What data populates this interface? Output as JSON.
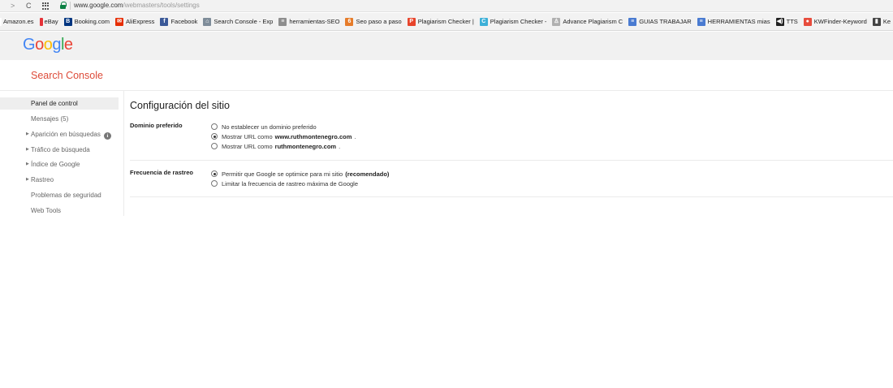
{
  "browser": {
    "url_domain": "www.google.com",
    "url_path": "/webmasters/tools/settings",
    "bookmarks": [
      {
        "label": "Amazon.es",
        "color": "#ffffff",
        "glyph": ""
      },
      {
        "label": "eBay",
        "color": "#e53238",
        "glyph": ""
      },
      {
        "label": "Booking.com",
        "color": "#003580",
        "glyph": "B"
      },
      {
        "label": "AliExpress",
        "color": "#e62e04",
        "glyph": "✉"
      },
      {
        "label": "Facebook",
        "color": "#3b5998",
        "glyph": "f"
      },
      {
        "label": "Search Console - Exp",
        "color": "#7e8c99",
        "glyph": "⌂"
      },
      {
        "label": "herramientas-SEO",
        "color": "#8e8e8e",
        "glyph": "≡"
      },
      {
        "label": "Seo paso a paso",
        "color": "#e67c2a",
        "glyph": "6"
      },
      {
        "label": "Plagiarism Checker |",
        "color": "#e8452c",
        "glyph": "P"
      },
      {
        "label": "Plagiarism Checker -",
        "color": "#3db0d8",
        "glyph": "C"
      },
      {
        "label": "Advance Plagiarism C",
        "color": "#b0b0b0",
        "glyph": "♙"
      },
      {
        "label": "GUIAS TRABAJAR",
        "color": "#4a7bd1",
        "glyph": "≡"
      },
      {
        "label": "HERRAMIENTAS mias",
        "color": "#4a7bd1",
        "glyph": "≡"
      },
      {
        "label": "TTS",
        "color": "#222222",
        "glyph": "◀)"
      },
      {
        "label": "KWFinder-Keyword",
        "color": "#e74c3c",
        "glyph": "●"
      },
      {
        "label": "Ke",
        "color": "#444444",
        "glyph": "▮"
      }
    ]
  },
  "header": {
    "logo": [
      "G",
      "o",
      "o",
      "g",
      "l",
      "e"
    ],
    "logo_colors": [
      "#4285f4",
      "#ea4335",
      "#fbbc05",
      "#4285f4",
      "#34a853",
      "#ea4335"
    ],
    "product_title": "Search Console"
  },
  "sidebar": {
    "items": [
      {
        "label": "Panel de control",
        "active": true,
        "expandable": false
      },
      {
        "label": "Mensajes (5)",
        "active": false,
        "expandable": false
      },
      {
        "label": "Aparición en búsquedas",
        "active": false,
        "expandable": true,
        "info": "i"
      },
      {
        "label": "Tráfico de búsqueda",
        "active": false,
        "expandable": true
      },
      {
        "label": "Índice de Google",
        "active": false,
        "expandable": true
      },
      {
        "label": "Rastreo",
        "active": false,
        "expandable": true
      },
      {
        "label": "Problemas de seguridad",
        "active": false,
        "expandable": false
      },
      {
        "label": "Web Tools",
        "active": false,
        "expandable": false
      }
    ]
  },
  "main": {
    "title": "Configuración del sitio",
    "preferred_domain": {
      "label": "Dominio preferido",
      "options": [
        {
          "prefix": "No establecer un dominio preferido",
          "bold": "",
          "suffix": "",
          "selected": false
        },
        {
          "prefix": "Mostrar URL como",
          "bold": "www.ruthmontenegro.com",
          "suffix": ".",
          "selected": true
        },
        {
          "prefix": "Mostrar URL como",
          "bold": "ruthmontenegro.com",
          "suffix": ".",
          "selected": false
        }
      ]
    },
    "crawl_rate": {
      "label": "Frecuencia de rastreo",
      "options": [
        {
          "prefix": "Permitir que Google se optimice para mi sitio",
          "bold": "(recomendado)",
          "suffix": "",
          "selected": true
        },
        {
          "prefix": "Limitar la frecuencia de rastreo máxima de Google",
          "bold": "",
          "suffix": "",
          "selected": false
        }
      ]
    }
  }
}
